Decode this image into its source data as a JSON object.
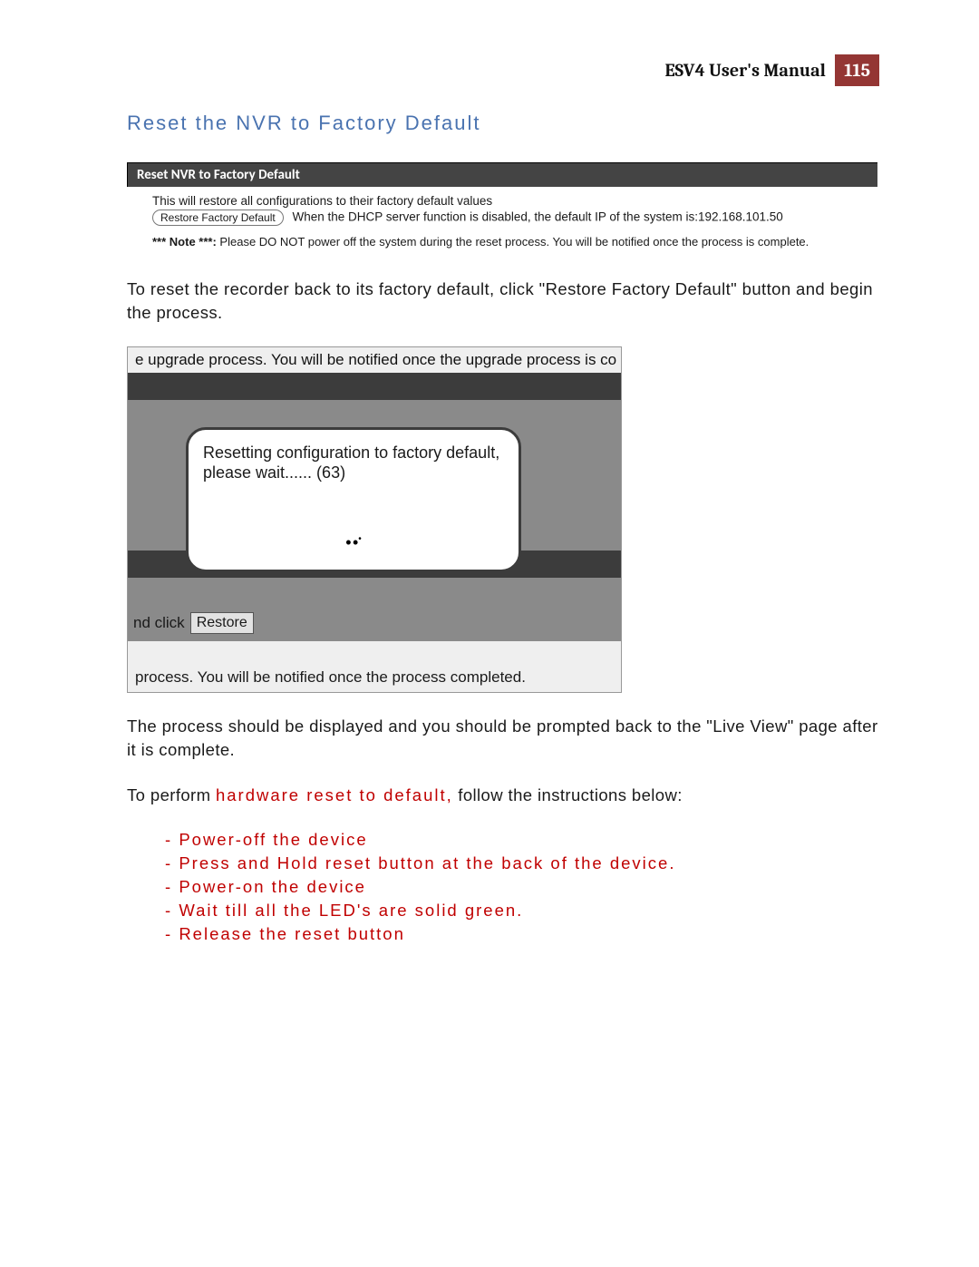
{
  "header": {
    "manual_title": "ESV4 User's Manual",
    "page_number": "115"
  },
  "section_heading": "Reset the NVR to Factory Default",
  "panel": {
    "title": "Reset NVR to Factory Default",
    "desc": "This will restore all configurations to their factory default values",
    "button_label": "Restore Factory Default",
    "dhcp_note": "When the DHCP server function is disabled, the default IP of the system is:192.168.101.50",
    "warn_label": "*** Note ***: ",
    "warn_text": "Please DO NOT power off the system during the reset process. You will be notified once the process is complete."
  },
  "para1": "To reset the recorder back to its factory default, click \"Restore Factory Default\" button and begin the process.",
  "shot2": {
    "top_line": "e upgrade process. You will be notified once the upgrade process is co",
    "dialog_text": "Resetting configuration to factory default, please wait...... (63)",
    "click_prefix": "nd click",
    "restore_label": "Restore",
    "bottom_line": "process. You will be notified once the process completed."
  },
  "para2": "The process should be displayed and you should be prompted back to the \"Live View\" page after it is complete.",
  "para3_pre": "To perform ",
  "para3_hw": "hardware reset to default,",
  "para3_post": " follow the instructions below:",
  "steps": [
    "Power-off the device",
    "Press and Hold reset button at the back of the device.",
    "Power-on the device",
    "Wait till all the LED's are solid green.",
    "Release the reset button"
  ]
}
